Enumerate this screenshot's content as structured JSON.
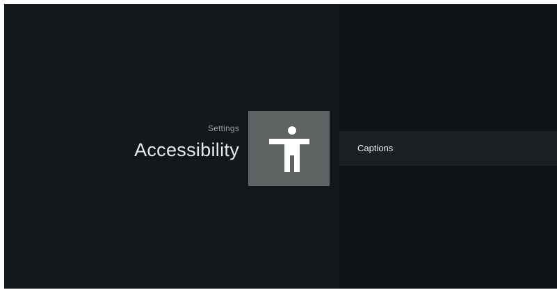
{
  "header": {
    "breadcrumb": "Settings",
    "title": "Accessibility",
    "icon": "accessibility-icon"
  },
  "menu": {
    "items": [
      {
        "label": "Captions"
      }
    ]
  },
  "colors": {
    "background": "#12171b",
    "right_pane": "#101315",
    "icon_tile": "#5d6262",
    "selected_item": "#1c1f21",
    "text_primary": "#e8eaeb",
    "text_secondary": "#9aa1a6"
  }
}
